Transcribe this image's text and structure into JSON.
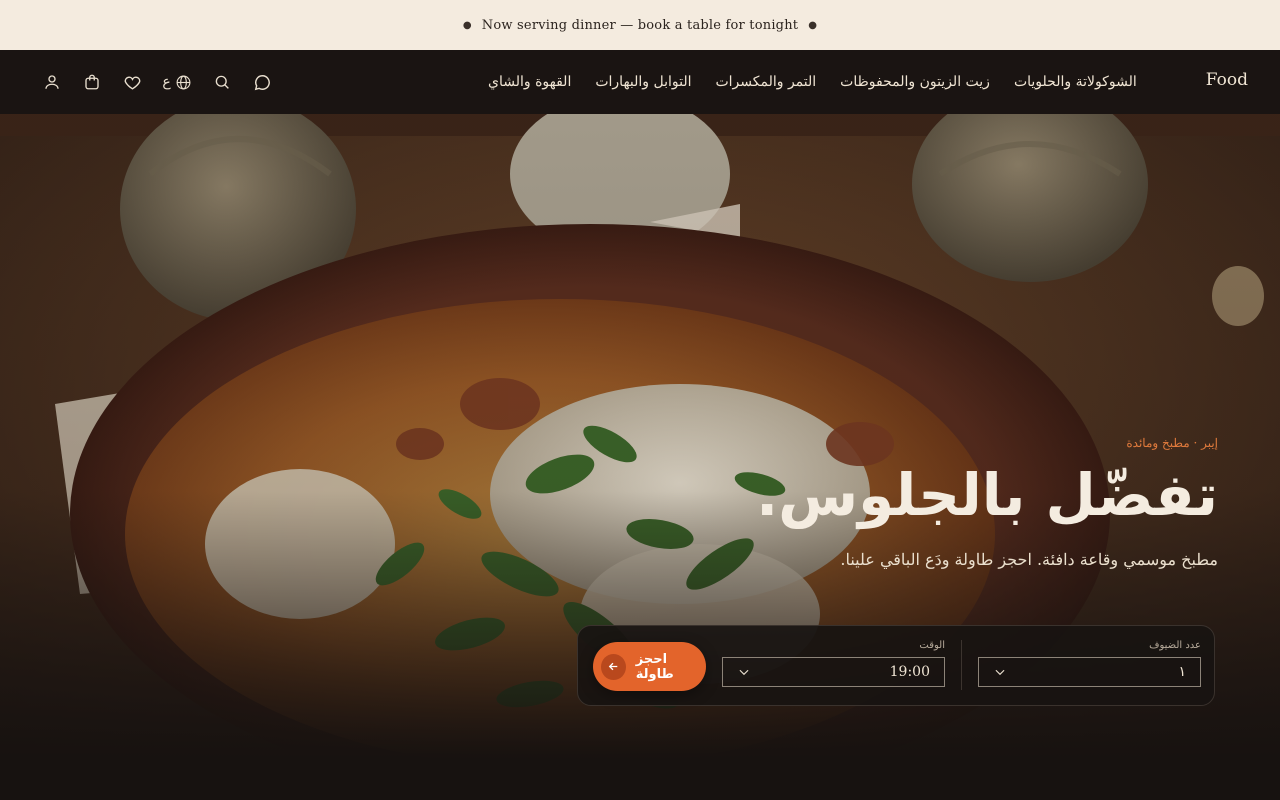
{
  "announcement": {
    "text": "Now serving dinner — book a table for tonight"
  },
  "nav": {
    "brand": "Food",
    "links": [
      "القهوة والشاي",
      "التوابل والبهارات",
      "التمر والمكسرات",
      "زيت الزيتون والمحفوظات",
      "الشوكولاتة والحلويات"
    ],
    "language_label": "ع",
    "icons": [
      "chat-icon",
      "search-icon",
      "globe-icon",
      "heart-icon",
      "bag-icon",
      "user-icon"
    ]
  },
  "hero": {
    "eyebrow": "إيبر · مطبخ ومائدة",
    "headline": "تفضّل بالجلوس.",
    "subtext": "مطبخ موسمي وقاعة دافئة. احجز طاولة ودَع الباقي علينا."
  },
  "booking": {
    "guests_label": "عدد الضيوف",
    "guests_value": "١",
    "time_label": "الوقت",
    "time_value": "19:00",
    "button_label": "احجز طاولة"
  },
  "colors": {
    "accent": "#e3642b",
    "announce_bg": "#f4ebdf",
    "nav_bg": "#1a1412"
  }
}
